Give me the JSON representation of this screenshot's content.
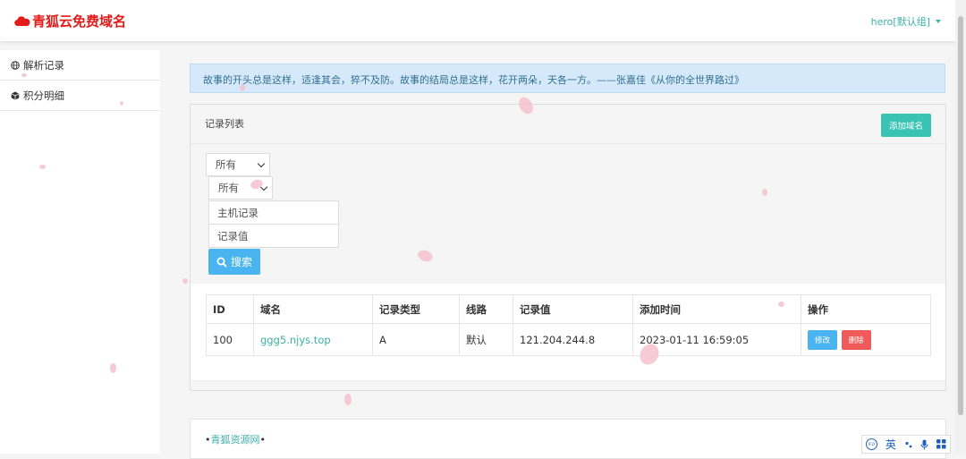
{
  "app": {
    "brand": "青狐云免费域名",
    "user": "hero[默认组]"
  },
  "sidebar": {
    "items": [
      {
        "label": "解析记录"
      },
      {
        "label": "积分明细"
      }
    ]
  },
  "notice": {
    "text": "故事的开头总是这样，适逢其会，猝不及防。故事的结局总是这样，花开两朵，天各一方。——张嘉佳《从你的全世界路过》"
  },
  "records": {
    "title": "记录列表",
    "add_label": "添加域名",
    "filters": {
      "select1": "所有",
      "select2": "所有",
      "host_placeholder": "主机记录",
      "value_placeholder": "记录值",
      "search_label": "搜索"
    },
    "table": {
      "headers": [
        "ID",
        "域名",
        "记录类型",
        "线路",
        "记录值",
        "添加时间",
        "操作"
      ],
      "rows": [
        {
          "id": "100",
          "domain": "ggg5.njys.top",
          "type": "A",
          "line": "默认",
          "value": "121.204.244.8",
          "time": "2023-01-11 16:59:05",
          "edit_label": "修改",
          "delete_label": "删除"
        }
      ]
    }
  },
  "footer": {
    "prefix": "•",
    "link": "青狐资源网",
    "suffix": "•"
  },
  "ime": {
    "lang": "英"
  }
}
